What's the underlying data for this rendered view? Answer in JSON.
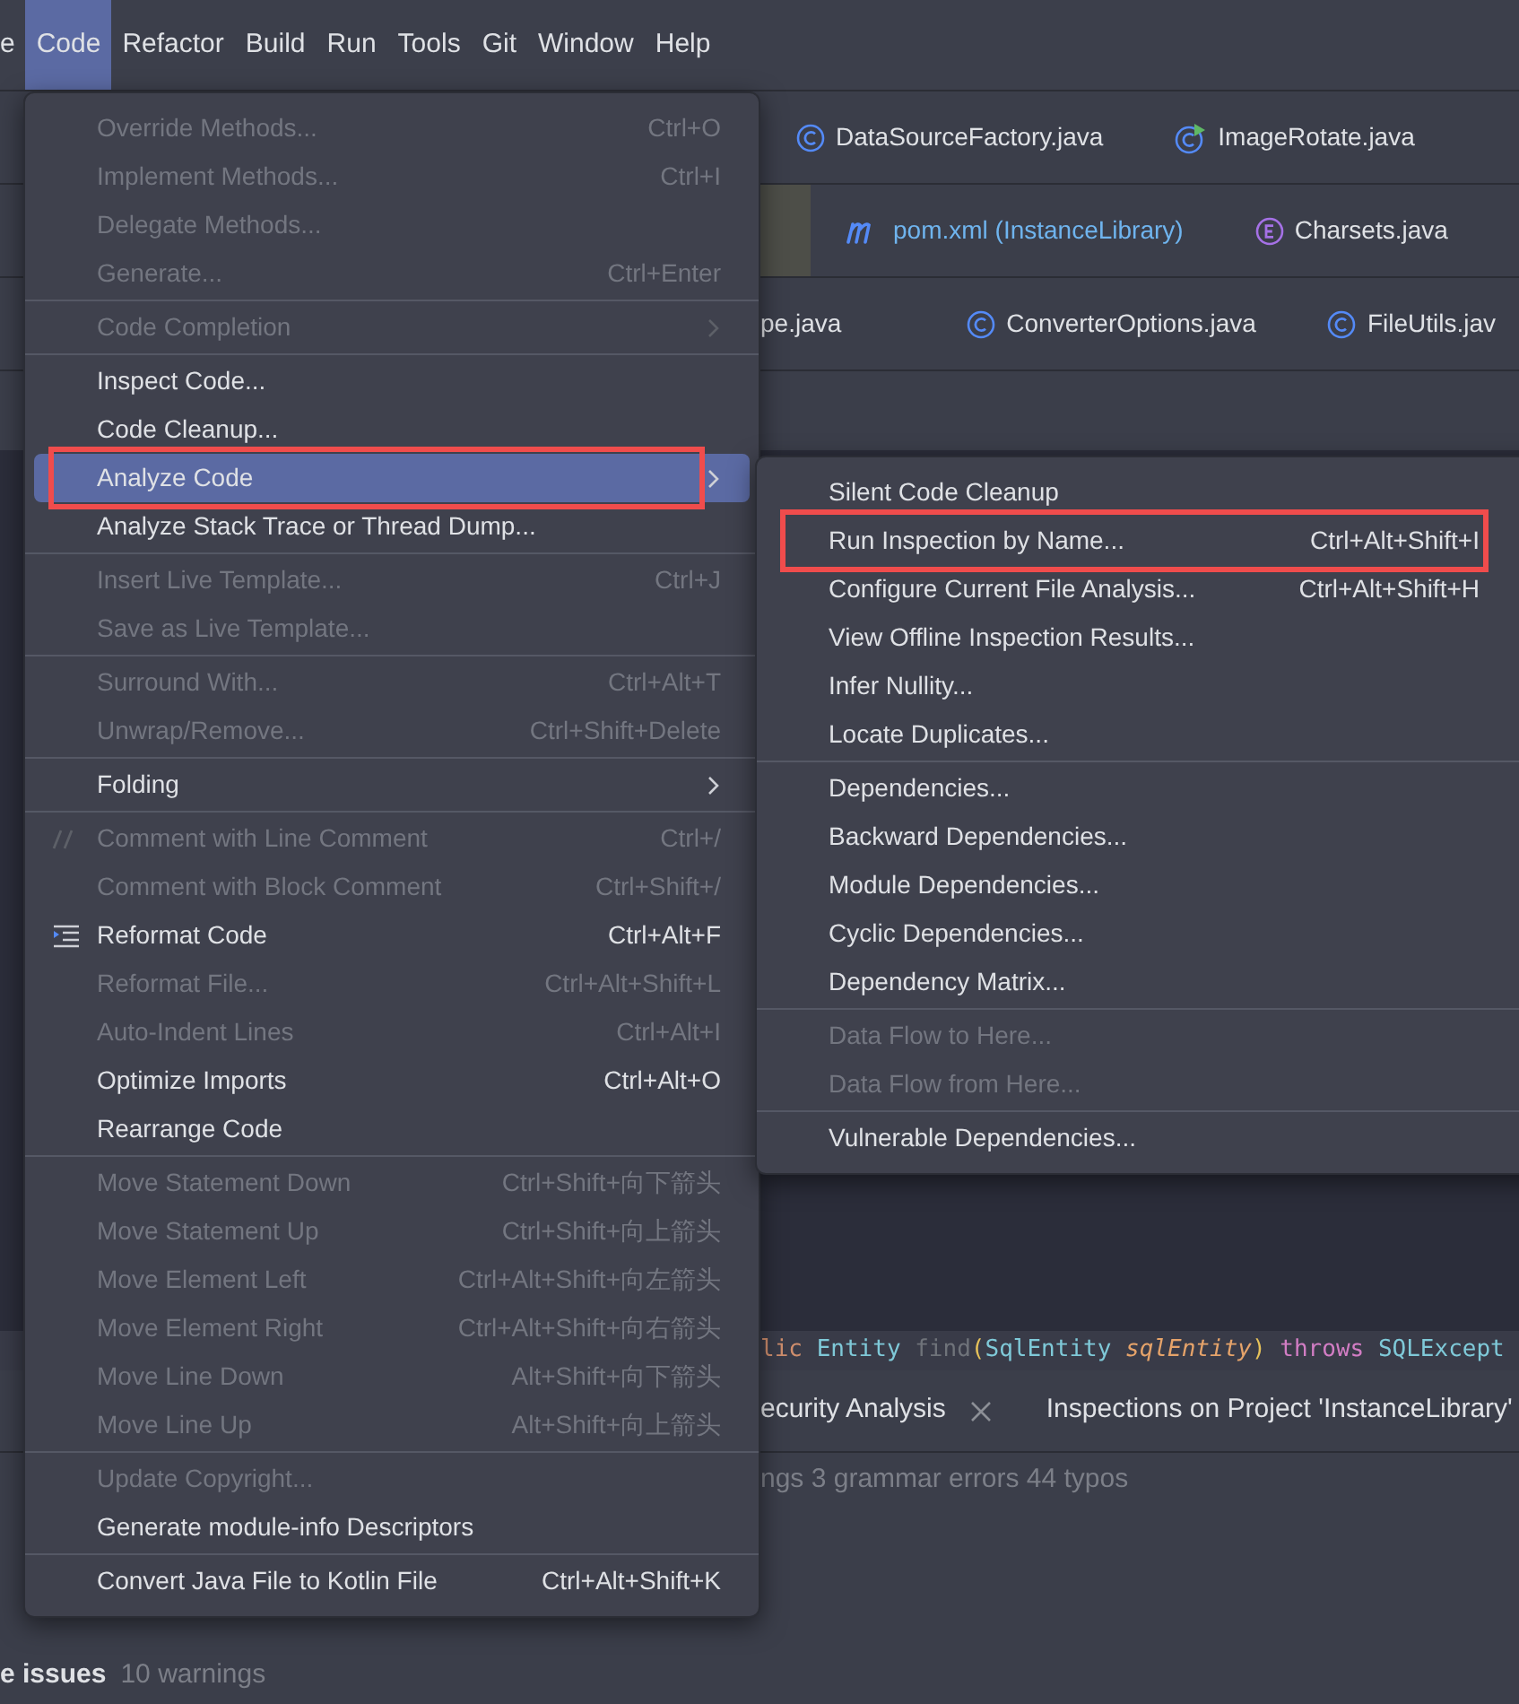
{
  "menu_bar": [
    {
      "label": "e",
      "selected": false
    },
    {
      "label": "Code",
      "selected": true
    },
    {
      "label": "Refactor",
      "selected": false
    },
    {
      "label": "Build",
      "selected": false
    },
    {
      "label": "Run",
      "selected": false
    },
    {
      "label": "Tools",
      "selected": false
    },
    {
      "label": "Git",
      "selected": false
    },
    {
      "label": "Window",
      "selected": false
    },
    {
      "label": "Help",
      "selected": false
    }
  ],
  "editor_tabs": [
    [
      {
        "label": "DataSourceFactory.java",
        "kind": "class",
        "modified": false
      },
      {
        "label": "ImageRotate.java",
        "kind": "runnable",
        "modified": false
      }
    ],
    [
      {
        "label": "pom.xml (InstanceLibrary)",
        "kind": "maven",
        "modified": true
      },
      {
        "label": "Charsets.java",
        "kind": "enum",
        "modified": false
      }
    ],
    [
      {
        "label": "pe.java",
        "kind": "none",
        "modified": false
      },
      {
        "label": "ConverterOptions.java",
        "kind": "class",
        "modified": false
      },
      {
        "label": "FileUtils.jav",
        "kind": "class",
        "modified": false
      }
    ]
  ],
  "code_line": [
    {
      "text": "lic ",
      "kind": "keyword"
    },
    {
      "text": "Entity ",
      "kind": "type"
    },
    {
      "text": "find",
      "kind": "unused"
    },
    {
      "text": "(",
      "kind": "paren"
    },
    {
      "text": "SqlEntity ",
      "kind": "type"
    },
    {
      "text": "sqlEntity",
      "kind": "param"
    },
    {
      "text": ") ",
      "kind": "paren"
    },
    {
      "text": "throws ",
      "kind": "flow"
    },
    {
      "text": "SQLExcept",
      "kind": "type"
    }
  ],
  "tool_tabs": [
    {
      "label": "ecurity Analysis",
      "closable": true
    },
    {
      "label": "Inspections on Project 'InstanceLibrary'"
    }
  ],
  "summary": "ngs 3 grammar errors 44 typos",
  "problems": [
    {
      "name": "e issues",
      "detail": "10 warnings"
    }
  ],
  "code_menu": [
    [
      {
        "label": "Override Methods...",
        "shortcut": "Ctrl+O",
        "disabled": true
      },
      {
        "label": "Implement Methods...",
        "shortcut": "Ctrl+I",
        "disabled": true
      },
      {
        "label": "Delegate Methods...",
        "disabled": true
      },
      {
        "label": "Generate...",
        "shortcut": "Ctrl+Enter",
        "disabled": true
      }
    ],
    [
      {
        "label": "Code Completion",
        "disabled": true,
        "submenu": true
      }
    ],
    [
      {
        "label": "Inspect Code...",
        "disabled": false
      },
      {
        "label": "Code Cleanup...",
        "disabled": false
      },
      {
        "label": "Analyze Code",
        "disabled": false,
        "submenu": true,
        "selected": true,
        "highlighted": true
      },
      {
        "label": "Analyze Stack Trace or Thread Dump...",
        "disabled": false
      }
    ],
    [
      {
        "label": "Insert Live Template...",
        "shortcut": "Ctrl+J",
        "disabled": true
      },
      {
        "label": "Save as Live Template...",
        "disabled": true
      }
    ],
    [
      {
        "label": "Surround With...",
        "shortcut": "Ctrl+Alt+T",
        "disabled": true
      },
      {
        "label": "Unwrap/Remove...",
        "shortcut": "Ctrl+Shift+Delete",
        "disabled": true
      }
    ],
    [
      {
        "label": "Folding",
        "disabled": false,
        "submenu": true
      }
    ],
    [
      {
        "label": "Comment with Line Comment",
        "shortcut": "Ctrl+/",
        "disabled": true,
        "kind": "comment"
      },
      {
        "label": "Comment with Block Comment",
        "shortcut": "Ctrl+Shift+/",
        "disabled": true
      },
      {
        "label": "Reformat Code",
        "shortcut": "Ctrl+Alt+F",
        "disabled": false,
        "kind": "reformat"
      },
      {
        "label": "Reformat File...",
        "shortcut": "Ctrl+Alt+Shift+L",
        "disabled": true
      },
      {
        "label": "Auto-Indent Lines",
        "shortcut": "Ctrl+Alt+I",
        "disabled": true
      },
      {
        "label": "Optimize Imports",
        "shortcut": "Ctrl+Alt+O",
        "disabled": false
      },
      {
        "label": "Rearrange Code",
        "disabled": false
      }
    ],
    [
      {
        "label": "Move Statement Down",
        "shortcut": "Ctrl+Shift+向下箭头",
        "disabled": true
      },
      {
        "label": "Move Statement Up",
        "shortcut": "Ctrl+Shift+向上箭头",
        "disabled": true
      },
      {
        "label": "Move Element Left",
        "shortcut": "Ctrl+Alt+Shift+向左箭头",
        "disabled": true
      },
      {
        "label": "Move Element Right",
        "shortcut": "Ctrl+Alt+Shift+向右箭头",
        "disabled": true
      },
      {
        "label": "Move Line Down",
        "shortcut": "Alt+Shift+向下箭头",
        "disabled": true
      },
      {
        "label": "Move Line Up",
        "shortcut": "Alt+Shift+向上箭头",
        "disabled": true
      }
    ],
    [
      {
        "label": "Update Copyright...",
        "disabled": true
      },
      {
        "label": "Generate module-info Descriptors",
        "disabled": false
      }
    ],
    [
      {
        "label": "Convert Java File to Kotlin File",
        "shortcut": "Ctrl+Alt+Shift+K",
        "disabled": false
      }
    ]
  ],
  "analyze_menu": [
    [
      {
        "label": "Silent Code Cleanup",
        "disabled": false
      },
      {
        "label": "Run Inspection by Name...",
        "shortcut": "Ctrl+Alt+Shift+I",
        "disabled": false,
        "highlighted": true
      },
      {
        "label": "Configure Current File Analysis...",
        "shortcut": "Ctrl+Alt+Shift+H",
        "disabled": false
      },
      {
        "label": "View Offline Inspection Results...",
        "disabled": false
      },
      {
        "label": "Infer Nullity...",
        "disabled": false
      },
      {
        "label": "Locate Duplicates...",
        "disabled": false
      }
    ],
    [
      {
        "label": "Dependencies...",
        "disabled": false
      },
      {
        "label": "Backward Dependencies...",
        "disabled": false
      },
      {
        "label": "Module Dependencies...",
        "disabled": false
      },
      {
        "label": "Cyclic Dependencies...",
        "disabled": false
      },
      {
        "label": "Dependency Matrix...",
        "disabled": false
      }
    ],
    [
      {
        "label": "Data Flow to Here...",
        "disabled": true
      },
      {
        "label": "Data Flow from Here...",
        "disabled": true
      }
    ],
    [
      {
        "label": "Vulnerable Dependencies...",
        "disabled": false
      }
    ]
  ]
}
